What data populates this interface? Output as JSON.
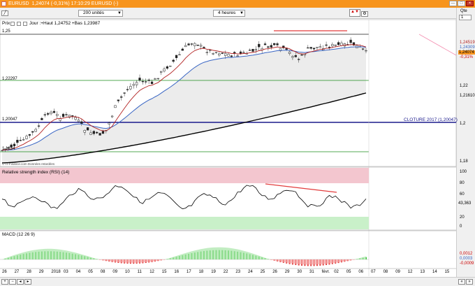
{
  "window": {
    "title": "EURUSD",
    "title_detail": "1,24074 (-0,31%) 17:10:29 EURUSD (-)",
    "controls": [
      "—",
      "□",
      "×"
    ]
  },
  "toolbar": {
    "units_select": "200 unités",
    "period_select": "4 heures",
    "qty_label": "Qte",
    "qty_value": "1"
  },
  "price_panel": {
    "label": "Prix",
    "info": "Jour :+Haut 1,24752 +Bas 1,23987",
    "copyright": "© IT-Finance.com Données retardées",
    "left_levels": [
      "1,25",
      "1,22297",
      "1,20047",
      "1,1834"
    ],
    "cloture_label": "CLOTURE 2017 (1,20047)",
    "axis_labels": [
      "1,24519",
      "1,24309",
      "1,24074",
      "-0,31%",
      "1,22",
      "1,21610",
      "1,2",
      "1,18"
    ]
  },
  "rsi_panel": {
    "label": "Relative strength index (RSI) (14)",
    "axis_labels": [
      "100",
      "80",
      "60",
      "43,363",
      "20",
      "0"
    ]
  },
  "macd_panel": {
    "label": "MACD (12 26 9)",
    "axis_labels": [
      "0,0012",
      "0,0003",
      "-0,0009"
    ]
  },
  "dates": [
    "26",
    "27",
    "28",
    "29",
    "2018",
    "03",
    "04",
    "05",
    "08",
    "09",
    "10",
    "11",
    "12",
    "15",
    "16",
    "17",
    "18",
    "19",
    "22",
    "23",
    "24",
    "25",
    "26",
    "29",
    "30",
    "31",
    "févr.",
    "02",
    "05",
    "06",
    "07",
    "08",
    "09",
    "12",
    "13",
    "14",
    "15"
  ],
  "colors": {
    "titlebar": "#f7941d",
    "ma_red": "#b22222",
    "ma_blue": "#3a66c4",
    "ma_black": "#000000",
    "level_green": "#1e8c1e",
    "cloture_blue": "#1a1a8c",
    "rsi_zone_top": "#f3c6cf",
    "rsi_zone_bottom": "#c9f0c9",
    "macd_pos": "#43c443",
    "macd_neg": "#e23c3c"
  }
}
